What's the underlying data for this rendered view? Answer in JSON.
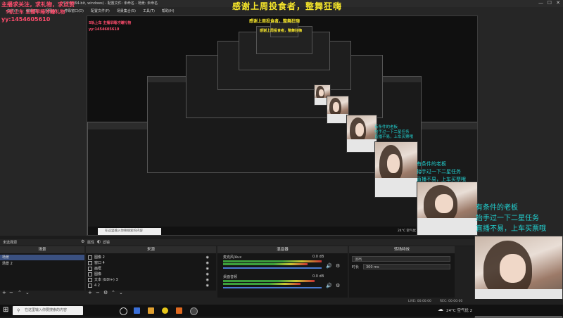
{
  "window": {
    "title_left": "5.2.1 (64-bit, windows) - 配置文件: 未命名 - 场景: 未命名",
    "menus": [
      "文件(F)",
      "编辑(E)",
      "视图(V)",
      "停靠窗口(D)",
      "配置文件(P)",
      "场景集合(S)",
      "工具(T)",
      "帮助(H)"
    ]
  },
  "overlay": {
    "top_banner": "感谢上周投食者，整舞狂嗨",
    "left_line1": "主播求关注，求礼物，求点赞",
    "left_line2": "5轨上车 主播早睡才赚礼物",
    "qq": "yy:1454605610",
    "boss_line1": "有条件的老板",
    "boss_line2": "抬手过一下二星任务",
    "boss_line3": "直播不易，上车买票哦",
    "nested_boss_line1": "有条件的老板",
    "nested_boss_line2": "抬手过一下二星任务",
    "nested_boss_line3": "直播不易，上车买票哦"
  },
  "scene_bar": {
    "label": "未选择源",
    "props": "属性",
    "filters": "滤镜"
  },
  "scenes": {
    "title": "场景",
    "items": [
      "场景",
      "场景 2"
    ]
  },
  "sources": {
    "title": "来源",
    "items": [
      "图像 2",
      "窗口 4",
      "画框",
      "图像",
      "文本 (GDI+) 3",
      "4 2"
    ]
  },
  "mixer": {
    "title": "混音器",
    "ch1_name": "麦克风/Aux",
    "ch1_db": "0.0 dB",
    "ch2_name": "桌面音频",
    "ch2_db": "0.0 dB"
  },
  "transitions": {
    "title": "转场特效",
    "type": "淡出",
    "duration_label": "时长",
    "duration_value": "300 ms"
  },
  "status": {
    "live": "LIVE: 00:00:00",
    "rec": "REC: 00:00:00"
  },
  "taskbar": {
    "search_placeholder": "在这里输入你要搜索的内容",
    "weather": "24°C 空气优 2",
    "nested_weather": "24°C 空气优 2"
  },
  "nested_taskbar": {
    "search_placeholder": "在这里输入你要搜索的内容"
  },
  "colors": {
    "accent_blue": "#3a5080",
    "overlay_red": "#ff4d6d",
    "overlay_yellow": "#f5e52a",
    "overlay_cyan": "#22d0d0"
  }
}
